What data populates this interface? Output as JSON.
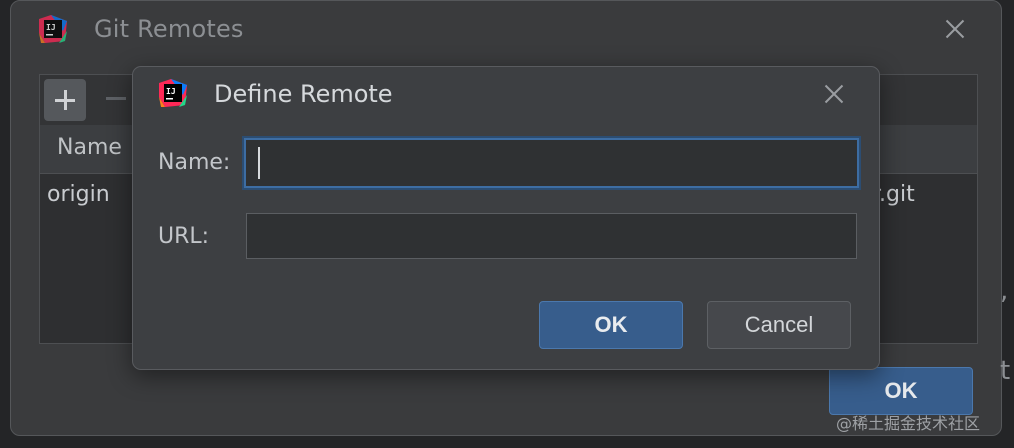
{
  "outer_dialog": {
    "title": "Git Remotes",
    "logo_icon": "intellij-idea-icon",
    "close_icon": "close-icon",
    "toolbar": {
      "add_icon": "plus-icon",
      "remove_icon": "minus-icon"
    },
    "table": {
      "header": "Name",
      "rows": [
        {
          "name": "origin",
          "url_tail": "r.git"
        }
      ]
    },
    "ok_label": "OK",
    "side_glyph_1": ",",
    "side_glyph_2": "t"
  },
  "inner_dialog": {
    "title": "Define Remote",
    "logo_icon": "intellij-idea-icon",
    "close_icon": "close-icon",
    "name_label": "Name:",
    "name_value": "",
    "url_label": "URL:",
    "url_value": "",
    "ok_label": "OK",
    "cancel_label": "Cancel"
  },
  "watermark": "@稀土掘金技术社区",
  "colors": {
    "accent": "#375d8c",
    "focus_border": "#3d6da3",
    "dialog_bg": "#3d3f42"
  }
}
